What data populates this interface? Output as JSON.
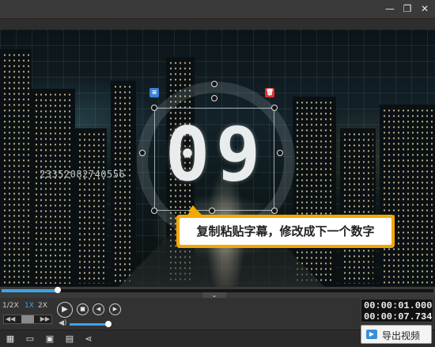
{
  "window": {
    "minimize_icon": "—",
    "restore_icon": "❐",
    "close_icon": "✕"
  },
  "video": {
    "background_number": "23352082740556",
    "counter_digits": [
      "0",
      "9"
    ],
    "tooltip": "复制粘贴字幕，修改成下一个数字",
    "delete_icon": "🗑",
    "menu_icon": "≡",
    "collapse_icon": "⌄"
  },
  "timeline": {
    "progress": 0.13
  },
  "playback": {
    "speeds": [
      "1/2X",
      "1X",
      "2X"
    ],
    "active_speed": "1X",
    "play_icon": "▶",
    "stop_icon": "■",
    "prev_icon": "◀",
    "next_icon": "▶",
    "rewind_icon": "◀◀",
    "forward_icon": "▶▶",
    "volume_icon": "◀)",
    "volume_level": 0.95
  },
  "time": {
    "current": "00:00:01.000",
    "total": "00:00:07.734"
  },
  "toolbar": {
    "new_icon": "▦",
    "open_icon": "▭",
    "save_icon": "▣",
    "settings_icon": "▤",
    "share_icon": "⋖",
    "export_label": "导出视频",
    "export_icon": "▶"
  },
  "colors": {
    "accent": "#3ba3e6",
    "tooltip": "#f2a900",
    "delete": "#e03030",
    "menu": "#3b7fd9"
  }
}
